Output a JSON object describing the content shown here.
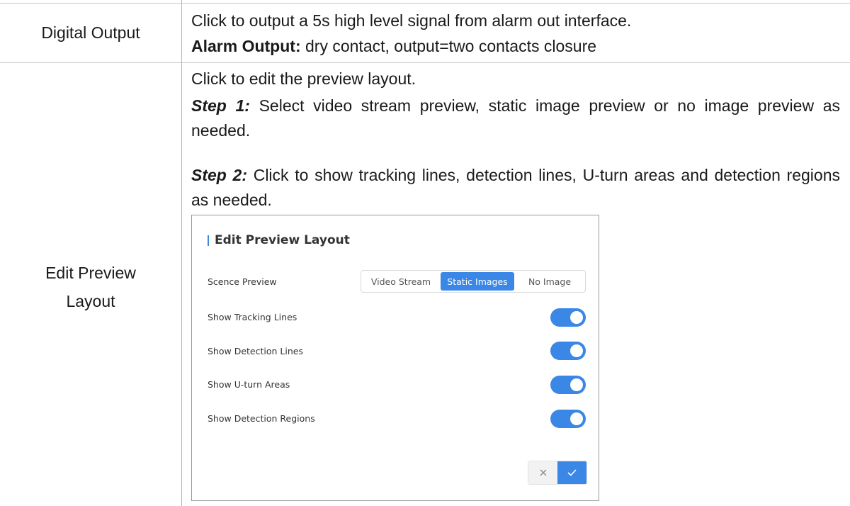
{
  "rows": [
    {
      "label": "Digital Output",
      "line1": "Click to output a 5s high level signal from alarm out interface.",
      "alarm_bold": "Alarm Output:",
      "alarm_rest": " dry contact, output=two contacts closure"
    },
    {
      "label_line1": "Edit Preview",
      "label_line2": "Layout",
      "intro": "Click to edit the preview layout.",
      "step1_label": "Step 1:",
      "step1_text": " Select video stream preview, static image preview or no image preview as needed.",
      "step2_label": "Step 2:",
      "step2_text": " Click to show tracking lines, detection lines, U-turn areas and detection regions as needed."
    }
  ],
  "screenshot": {
    "title": "Edit Preview Layout",
    "scene_preview_label": "Scence Preview",
    "segment_options": [
      "Video Stream",
      "Static Images",
      "No Image"
    ],
    "selected_option": "Static Images",
    "toggles": [
      {
        "label": "Show Tracking Lines",
        "on": true
      },
      {
        "label": "Show Detection Lines",
        "on": true
      },
      {
        "label": "Show U-turn Areas",
        "on": true
      },
      {
        "label": "Show Detection Regions",
        "on": true
      }
    ],
    "accent_color": "#3a87e6",
    "cancel_icon": "close-icon",
    "confirm_icon": "check-icon"
  }
}
